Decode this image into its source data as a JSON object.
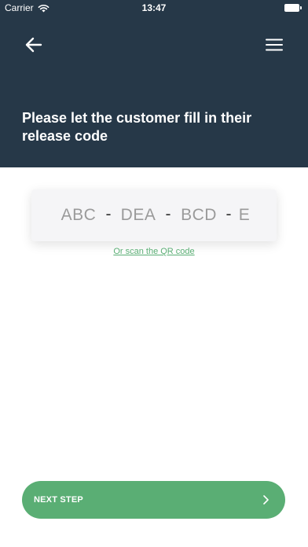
{
  "status_bar": {
    "carrier": "Carrier",
    "time": "13:47",
    "icons": [
      "wifi-icon",
      "battery-icon"
    ]
  },
  "header": {
    "back_icon": "arrow-left-icon",
    "menu_icon": "hamburger-menu-icon",
    "title": "Please let the customer fill in their release code"
  },
  "code_input": {
    "segments": [
      "ABC",
      "DEA",
      "BCD",
      "E"
    ],
    "separator": "-"
  },
  "scan_link": "Or scan the QR code",
  "next_button": {
    "label": "NEXT STEP",
    "icon": "chevron-right-icon"
  },
  "colors": {
    "header_bg": "#263848",
    "accent": "#5aae74",
    "card_bg": "#f5f5f7"
  }
}
